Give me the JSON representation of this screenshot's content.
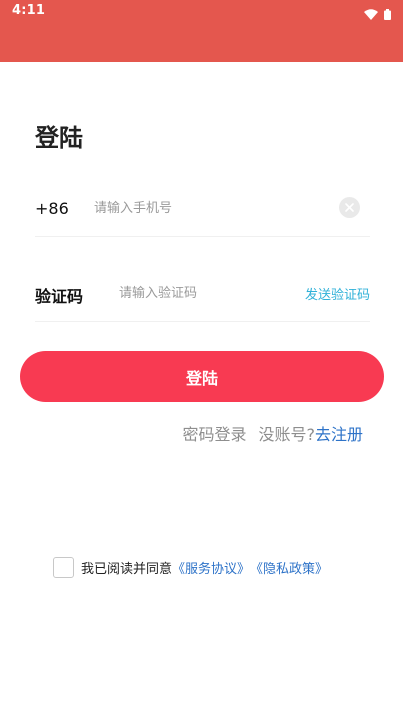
{
  "status_bar": {
    "time": "4:11",
    "color": "#e4574e",
    "icons": [
      "wifi-icon",
      "battery-icon"
    ]
  },
  "page": {
    "title": "登陆"
  },
  "phone": {
    "country_code": "+86",
    "placeholder": "请输入手机号",
    "clear_icon": "clear-icon"
  },
  "code": {
    "label": "验证码",
    "placeholder": "请输入验证码",
    "send_label": "发送验证码"
  },
  "login_button": {
    "label": "登陆",
    "color": "#f83a52"
  },
  "links": {
    "password_login": "密码登录",
    "no_account": "没账号?",
    "register": "去注册"
  },
  "agreement": {
    "text": "我已阅读并同意",
    "service": "《服务协议》",
    "privacy": "《隐私政策》"
  },
  "colors": {
    "accent_link": "#2e73c8",
    "send_code": "#2fb1d8"
  }
}
